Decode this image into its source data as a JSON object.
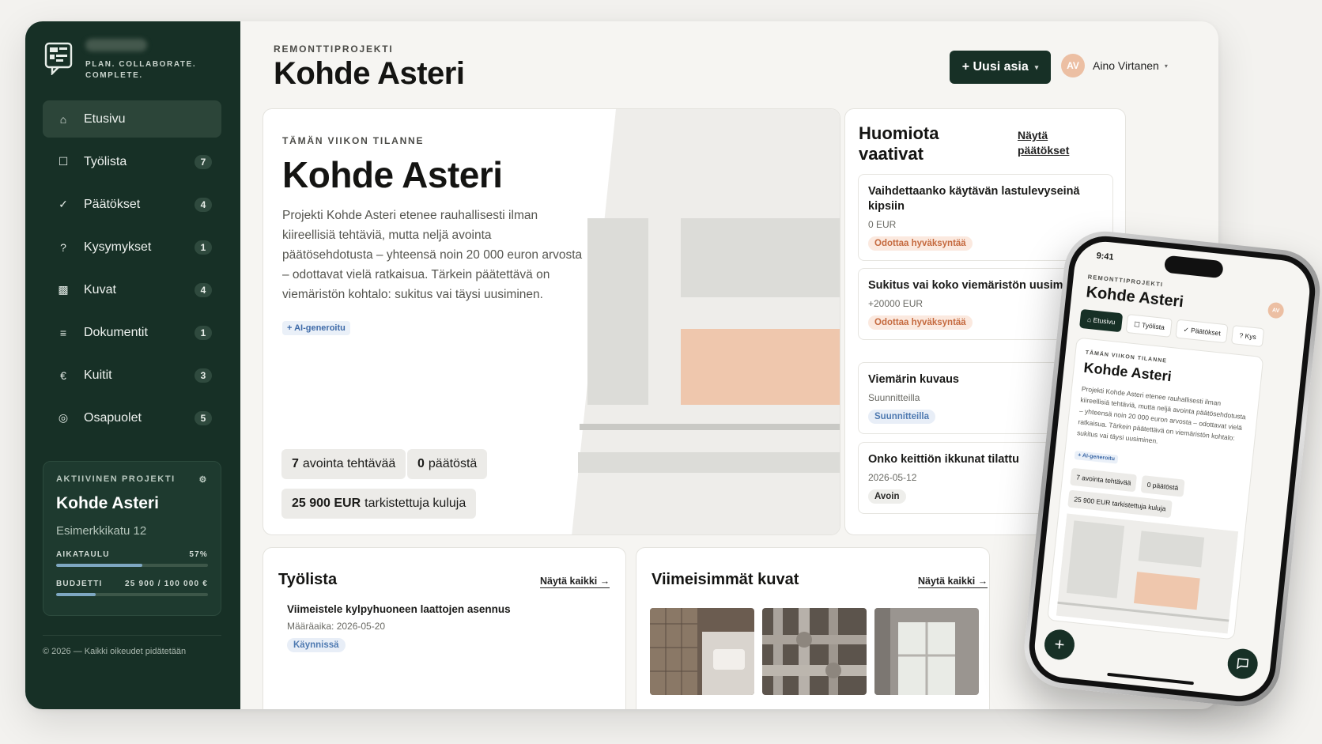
{
  "app": {
    "tagline": "PLAN. COLLABORATE. COMPLETE.",
    "eyebrow": "REMONTTIPROJEKTI",
    "title": "Kohde Asteri",
    "new_button": "+ Uusi asia",
    "user": {
      "initials": "AV",
      "name": "Aino Virtanen"
    }
  },
  "sidebar": {
    "items": [
      {
        "label": "Etusivu",
        "icon": "home-icon",
        "glyph": "⌂",
        "count": ""
      },
      {
        "label": "Työlista",
        "icon": "checkbox-icon",
        "glyph": "☐",
        "count": "7"
      },
      {
        "label": "Päätökset",
        "icon": "check-icon",
        "glyph": "✓",
        "count": "4"
      },
      {
        "label": "Kysymykset",
        "icon": "question-icon",
        "glyph": "?",
        "count": "1"
      },
      {
        "label": "Kuvat",
        "icon": "image-icon",
        "glyph": "▩",
        "count": "4"
      },
      {
        "label": "Dokumentit",
        "icon": "document-icon",
        "glyph": "≡",
        "count": "1"
      },
      {
        "label": "Kuitit",
        "icon": "euro-icon",
        "glyph": "€",
        "count": "3"
      },
      {
        "label": "Osapuolet",
        "icon": "people-icon",
        "glyph": "◎",
        "count": "5"
      }
    ],
    "active_project": {
      "heading": "AKTIIVINEN PROJEKTI",
      "name": "Kohde Asteri",
      "address": "Esimerkkikatu 12",
      "schedule_label": "AIKATAULU",
      "schedule_value": "57%",
      "schedule_fraction": 0.57,
      "budget_label": "BUDJETTI",
      "budget_value": "25 900 / 100 000 €",
      "budget_fraction": 0.259
    },
    "copyright": "© 2026 — Kaikki oikeudet pidätetään"
  },
  "hero": {
    "eyebrow": "TÄMÄN VIIKON TILANNE",
    "title": "Kohde Asteri",
    "description": "Projekti Kohde Asteri etenee rauhallisesti ilman kiireellisiä tehtäviä, mutta neljä avointa päätösehdotusta – yhteensä noin 20 000 euron arvosta – odottavat vielä ratkaisua. Tärkein päätettävä on viemäristön kohtalo: sukitus vai täysi uusiminen.",
    "ai_badge": "+ AI-generoitu",
    "chips": [
      {
        "value": "7",
        "label": "avointa tehtävää"
      },
      {
        "value": "0",
        "label": "päätöstä"
      },
      {
        "value": "25 900 EUR",
        "label": "tarkistettuja kuluja"
      }
    ]
  },
  "attention": {
    "title": "Huomiota vaativat",
    "link": "Näytä päätökset",
    "items": [
      {
        "title": "Vaihdettaanko käytävän lastulevyseinä kipsiin",
        "sub": "0 EUR",
        "status": "Odottaa hyväksyntää",
        "kind": "wait"
      },
      {
        "title": "Sukitus vai koko viemäristön uusiminen?",
        "sub": "+20000 EUR",
        "status": "Odottaa hyväksyntää",
        "kind": "wait"
      },
      {
        "title": "Viemärin kuvaus",
        "sub": "Suunnitteilla",
        "status": "Suunnitteilla",
        "kind": "plan"
      },
      {
        "title": "Onko keittiön ikkunat tilattu",
        "sub": "2026-05-12",
        "status": "Avoin",
        "kind": "open"
      }
    ]
  },
  "worklist": {
    "title": "Työlista",
    "link": "Näytä kaikki →",
    "task": {
      "title": "Viimeistele kylpyhuoneen laattojen asennus",
      "due": "Määräaika: 2026-05-20",
      "status": "Käynnissä"
    }
  },
  "photos": {
    "title": "Viimeisimmät kuvat",
    "link": "Näytä kaikki →"
  },
  "phone": {
    "time": "9:41",
    "eyebrow": "REMONTTIPROJEKTI",
    "title": "Kohde Asteri",
    "avatar": "AV",
    "tabs": [
      "Etusivu",
      "Työlista",
      "Päätökset",
      "Kys"
    ],
    "card_eyebrow": "TÄMÄN VIIKON TILANNE",
    "card_title": "Kohde Asteri",
    "card_desc": "Projekti Kohde Asteri etenee rauhallisesti ilman kiireellisiä tehtäviä, mutta neljä avointa päätösehdotusta – yhteensä noin 20 000 euron arvosta – odottavat vielä ratkaisua. Tärkein päätettävä on viemäristön kohtalo: sukitus vai täysi uusiminen.",
    "ai": "+ AI-generoitu",
    "chip1": "7 avointa tehtävää",
    "chip2": "0 päätöstä",
    "chip3": "25 900 EUR tarkistettuja kuluja"
  },
  "colors": {
    "brand": "#173026",
    "accent": "#ecbfa3",
    "waiting": "#c56a3f",
    "planning": "#4f7ab1"
  }
}
